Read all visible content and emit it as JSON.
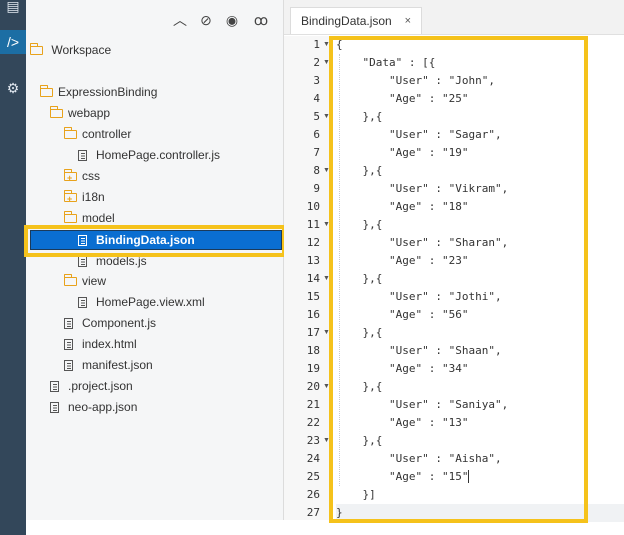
{
  "tree": {
    "root": "Workspace",
    "items": [
      {
        "label": "ExpressionBinding",
        "kind": "folder"
      },
      {
        "label": "webapp",
        "kind": "folder"
      },
      {
        "label": "controller",
        "kind": "folder"
      },
      {
        "label": "HomePage.controller.js",
        "kind": "file"
      },
      {
        "label": "css",
        "kind": "folder-plus"
      },
      {
        "label": "i18n",
        "kind": "folder-plus"
      },
      {
        "label": "model",
        "kind": "folder"
      },
      {
        "label": "BindingData.json",
        "kind": "file",
        "selected": true
      },
      {
        "label": "models.js",
        "kind": "file"
      },
      {
        "label": "view",
        "kind": "folder"
      },
      {
        "label": "HomePage.view.xml",
        "kind": "file"
      },
      {
        "label": "Component.js",
        "kind": "file"
      },
      {
        "label": "index.html",
        "kind": "file"
      },
      {
        "label": "manifest.json",
        "kind": "file"
      },
      {
        "label": ".project.json",
        "kind": "file"
      },
      {
        "label": "neo-app.json",
        "kind": "file"
      }
    ]
  },
  "editor": {
    "tab_title": "BindingData.json",
    "tab_close": "×",
    "lines": [
      "{",
      "    \"Data\" : [{",
      "        \"User\" : \"John\",",
      "        \"Age\" : \"25\"",
      "    },{",
      "        \"User\" : \"Sagar\",",
      "        \"Age\" : \"19\"",
      "    },{",
      "        \"User\" : \"Vikram\",",
      "        \"Age\" : \"18\"",
      "    },{",
      "        \"User\" : \"Sharan\",",
      "        \"Age\" : \"23\"",
      "    },{",
      "        \"User\" : \"Jothi\",",
      "        \"Age\" : \"56\"",
      "    },{",
      "        \"User\" : \"Shaan\",",
      "        \"Age\" : \"34\"",
      "    },{",
      "        \"User\" : \"Saniya\",",
      "        \"Age\" : \"13\"",
      "    },{",
      "        \"User\" : \"Aisha\",",
      "        \"Age\" : \"15\"",
      "    }]",
      "}"
    ],
    "fold_lines": [
      1,
      2,
      5,
      8,
      11,
      14,
      17,
      20,
      23
    ],
    "current_line": 25
  },
  "colors": {
    "selection": "#0a6ed1",
    "highlight_box": "#f5c21b",
    "rail": "#33475a"
  }
}
